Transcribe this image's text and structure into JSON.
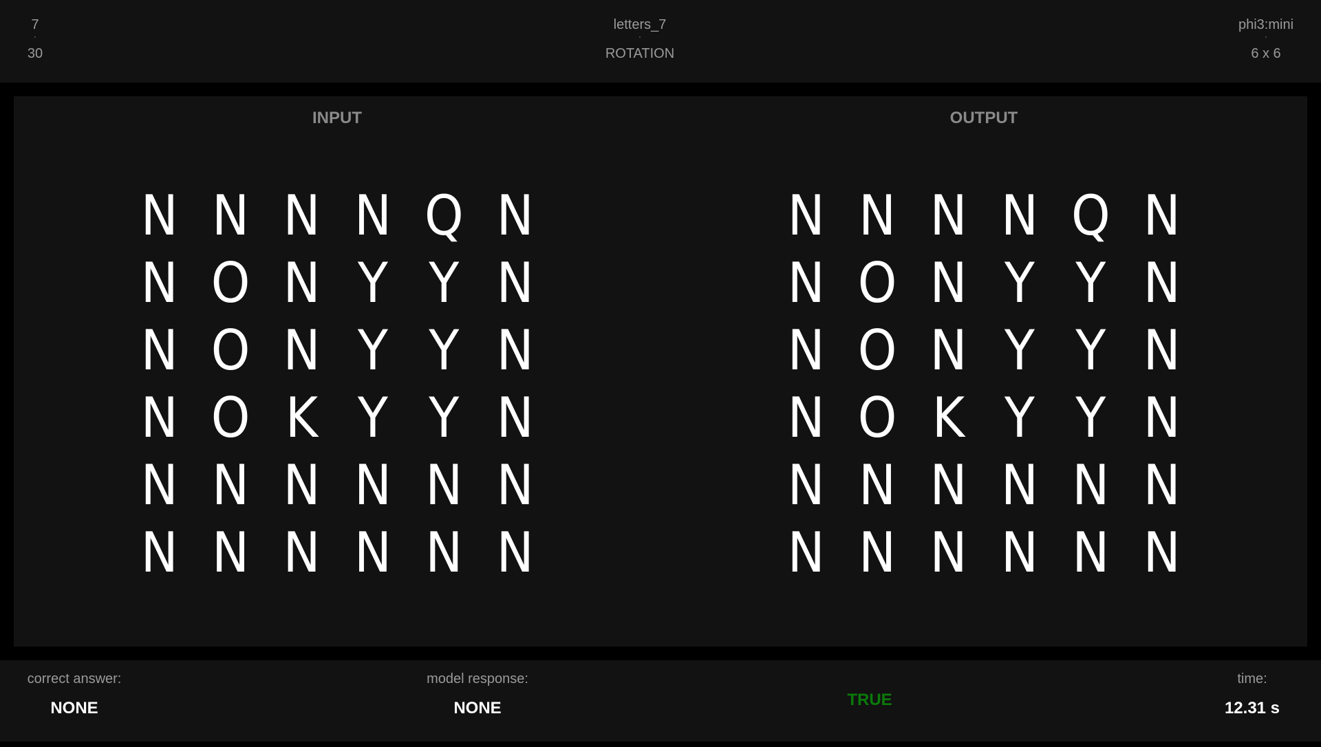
{
  "header": {
    "index": "7",
    "total": "30",
    "task_name": "letters_7",
    "transform": "ROTATION",
    "model": "phi3:mini",
    "grid_size": "6 x 6",
    "separator": "·"
  },
  "panels": {
    "input_title": "INPUT",
    "output_title": "OUTPUT"
  },
  "input_grid": [
    [
      "N",
      "N",
      "N",
      "N",
      "Q",
      "N"
    ],
    [
      "N",
      "O",
      "N",
      "Y",
      "Y",
      "N"
    ],
    [
      "N",
      "O",
      "N",
      "Y",
      "Y",
      "N"
    ],
    [
      "N",
      "O",
      "K",
      "Y",
      "Y",
      "N"
    ],
    [
      "N",
      "N",
      "N",
      "N",
      "N",
      "N"
    ],
    [
      "N",
      "N",
      "N",
      "N",
      "N",
      "N"
    ]
  ],
  "output_grid": [
    [
      "N",
      "N",
      "N",
      "N",
      "Q",
      "N"
    ],
    [
      "N",
      "O",
      "N",
      "Y",
      "Y",
      "N"
    ],
    [
      "N",
      "O",
      "N",
      "Y",
      "Y",
      "N"
    ],
    [
      "N",
      "O",
      "K",
      "Y",
      "Y",
      "N"
    ],
    [
      "N",
      "N",
      "N",
      "N",
      "N",
      "N"
    ],
    [
      "N",
      "N",
      "N",
      "N",
      "N",
      "N"
    ]
  ],
  "footer": {
    "correct_answer_label": "correct answer:",
    "correct_answer_value": "NONE",
    "model_response_label": "model response:",
    "model_response_value": "NONE",
    "result": "TRUE",
    "result_color": "#0a7a0a",
    "time_label": "time:",
    "time_value": "12.31 s"
  }
}
